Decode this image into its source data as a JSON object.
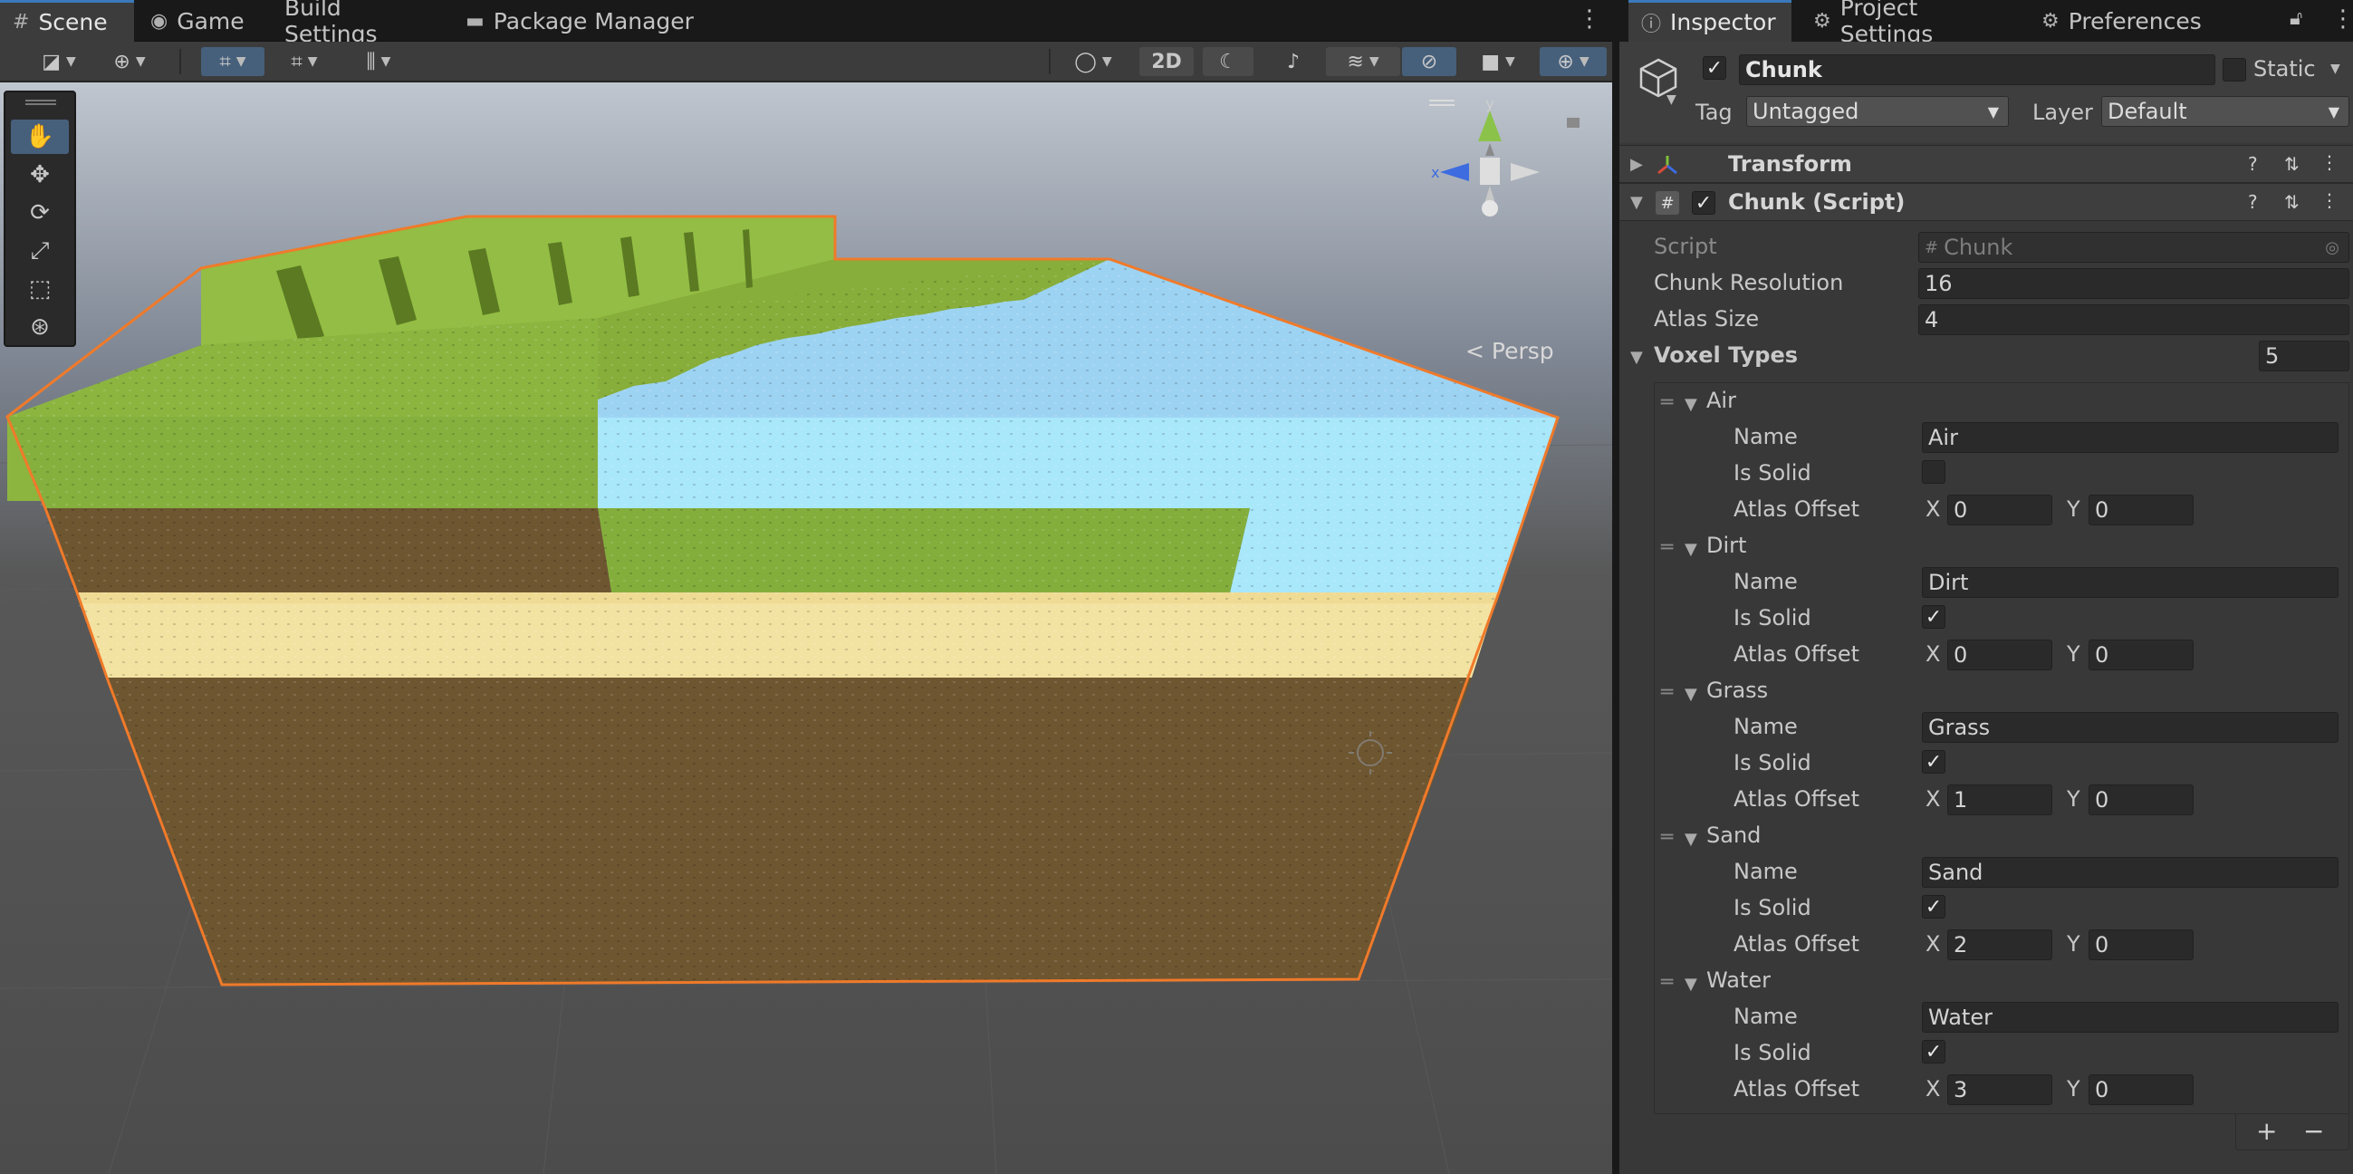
{
  "scene_tabs": [
    {
      "label": "Scene",
      "icon": "grid-icon",
      "active": true
    },
    {
      "label": "Game",
      "icon": "gamepad-icon",
      "active": false
    },
    {
      "label": "Build Settings",
      "icon": "",
      "active": false
    },
    {
      "label": "Package Manager",
      "icon": "package-icon",
      "active": false
    }
  ],
  "scene_toolbar": {
    "mode_2d": "2D"
  },
  "viewport": {
    "projection_label": "Persp",
    "gizmo_y_label": "y",
    "gizmo_x_label": "x"
  },
  "inspector_tabs": [
    {
      "label": "Inspector",
      "icon": "info-icon",
      "active": true
    },
    {
      "label": "Project Settings",
      "icon": "gear-icon",
      "active": false
    },
    {
      "label": "Preferences",
      "icon": "gear-icon",
      "active": false
    }
  ],
  "gameobject": {
    "name": "Chunk",
    "active": true,
    "static_label": "Static",
    "static": false,
    "tag_label": "Tag",
    "tag_value": "Untagged",
    "layer_label": "Layer",
    "layer_value": "Default"
  },
  "components": {
    "transform_title": "Transform",
    "script_title": "Chunk (Script)"
  },
  "script_fields": {
    "script_label": "Script",
    "script_value": "Chunk",
    "chunk_resolution_label": "Chunk Resolution",
    "chunk_resolution_value": "16",
    "atlas_size_label": "Atlas Size",
    "atlas_size_value": "4",
    "voxel_types_label": "Voxel Types",
    "voxel_types_count": "5"
  },
  "field_labels": {
    "name": "Name",
    "is_solid": "Is Solid",
    "atlas_offset": "Atlas Offset",
    "x": "X",
    "y": "Y"
  },
  "voxel_types": [
    {
      "title": "Air",
      "name": "Air",
      "is_solid": false,
      "offset_x": "0",
      "offset_y": "0"
    },
    {
      "title": "Dirt",
      "name": "Dirt",
      "is_solid": true,
      "offset_x": "0",
      "offset_y": "0"
    },
    {
      "title": "Grass",
      "name": "Grass",
      "is_solid": true,
      "offset_x": "1",
      "offset_y": "0"
    },
    {
      "title": "Sand",
      "name": "Sand",
      "is_solid": true,
      "offset_x": "2",
      "offset_y": "0"
    },
    {
      "title": "Water",
      "name": "Water",
      "is_solid": true,
      "offset_x": "3",
      "offset_y": "0"
    }
  ],
  "list_buttons": {
    "add": "+",
    "remove": "−"
  },
  "colors": {
    "grass": "#8fb63e",
    "dirt": "#6e5631",
    "sand": "#f3e3a2",
    "water": "#a9e7fb",
    "selection_outline": "#f07a2a",
    "accent": "#3a79bb"
  }
}
